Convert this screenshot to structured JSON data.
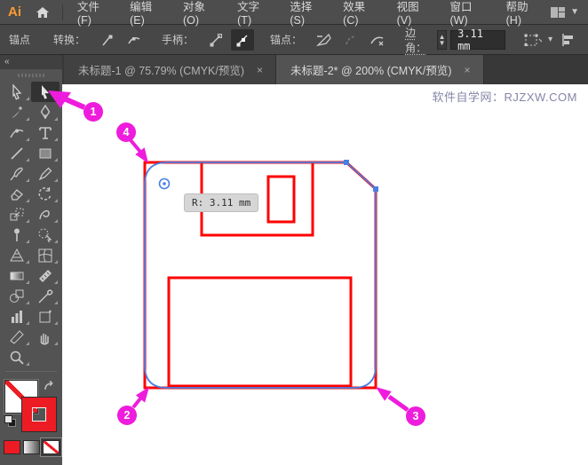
{
  "menu_bar": {
    "logo": "Ai",
    "items": [
      {
        "label": "文件(F)"
      },
      {
        "label": "编辑(E)"
      },
      {
        "label": "对象(O)"
      },
      {
        "label": "文字(T)"
      },
      {
        "label": "选择(S)"
      },
      {
        "label": "效果(C)"
      },
      {
        "label": "视图(V)"
      },
      {
        "label": "窗口(W)"
      },
      {
        "label": "帮助(H)"
      }
    ]
  },
  "control_bar": {
    "panel_label": "锚点",
    "convert_label": "转换：",
    "handles_label": "手柄：",
    "anchors_label": "锚点：",
    "corner_label": "边角：",
    "corner_value": "3.11 mm"
  },
  "tools_panel": {
    "collapse_glyph": "«"
  },
  "tabs": [
    {
      "label": "未标题-1 @ 75.79% (CMYK/预览)",
      "close": "×",
      "active": false
    },
    {
      "label": "未标题-2* @ 200% (CMYK/预览)",
      "close": "×",
      "active": true
    }
  ],
  "canvas": {
    "watermark": "软件自学网：RJZXW.COM",
    "corner_tooltip": "R: 3.11 mm"
  },
  "callouts": [
    {
      "n": "1"
    },
    {
      "n": "2"
    },
    {
      "n": "3"
    },
    {
      "n": "4"
    }
  ],
  "colors": {
    "artwork_stroke": "#ff0000",
    "selection_blue": "#4a7fe3",
    "callout_magenta": "#ee1cdc",
    "stroke_swatch": "#ed1c24",
    "ui_dark": "#474747",
    "canvas_bg": "#ffffff"
  }
}
